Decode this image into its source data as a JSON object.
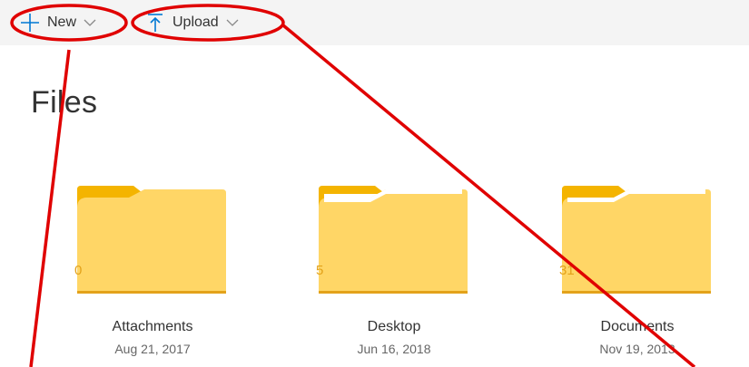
{
  "toolbar": {
    "new_label": "New",
    "upload_label": "Upload",
    "icons": {
      "new": "plus-icon",
      "upload": "upload-arrow-icon",
      "chevron": "chevron-down-icon"
    }
  },
  "main": {
    "title": "Files",
    "folders": [
      {
        "name": "Attachments",
        "date": "Aug 21, 2017",
        "count": "0"
      },
      {
        "name": "Desktop",
        "date": "Jun 16, 2018",
        "count": "5"
      },
      {
        "name": "Documents",
        "date": "Nov 19, 2013",
        "count": "31"
      }
    ]
  },
  "colors": {
    "accent": "#0078d4",
    "folder_back": "#f4b400",
    "folder_front": "#ffd666",
    "folder_paper": "#ffffff",
    "annotation": "#e00000"
  }
}
